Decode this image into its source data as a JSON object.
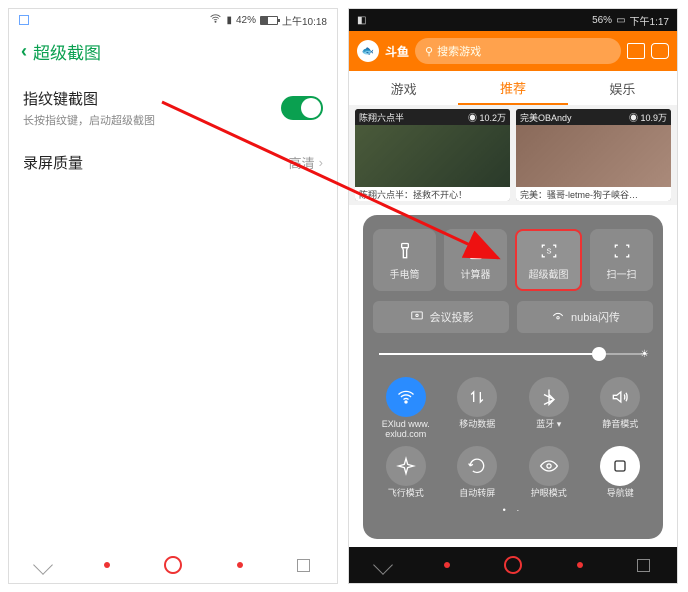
{
  "left": {
    "status": {
      "battery_pct": "42%",
      "time": "上午10:18"
    },
    "header": {
      "title": "超级截图"
    },
    "rows": [
      {
        "title": "指纹键截图",
        "subtitle": "长按指纹键，启动超级截图"
      },
      {
        "title": "录屏质量",
        "value": "高清"
      }
    ]
  },
  "right": {
    "status": {
      "signal": "56%",
      "time": "下午1:17"
    },
    "topbar": {
      "logo_text": "斗鱼",
      "search_placeholder": "搜索游戏"
    },
    "tabs": [
      "游戏",
      "推荐",
      "娱乐"
    ],
    "tabs_active": 1,
    "cards": [
      {
        "top_left": "陈翔六点半",
        "top_right": "◉ 10.2万",
        "bottom": "陈翔六点半：拯救不开心！"
      },
      {
        "top_left": "完美OBAndy",
        "top_right": "◉ 10.9万",
        "bottom": "完美：骚哥-letme-狗子峡谷…"
      }
    ],
    "cc": {
      "shortcuts": [
        {
          "label": "手电筒",
          "icon": "flashlight-icon"
        },
        {
          "label": "计算器",
          "icon": "calculator-icon"
        },
        {
          "label": "超级截图",
          "icon": "screenshot-icon",
          "highlight": true
        },
        {
          "label": "扫一扫",
          "icon": "scan-icon"
        }
      ],
      "wide": [
        {
          "label": "会议投影",
          "icon": "cast-icon"
        },
        {
          "label": "nubia闪传",
          "icon": "share-icon"
        }
      ],
      "quick": [
        {
          "label_line1": "EXlud www.",
          "label_line2": "exlud.com",
          "icon": "wifi-icon",
          "state": "on"
        },
        {
          "label_line1": "移动数据",
          "label_line2": "",
          "icon": "data-icon",
          "state": "off"
        },
        {
          "label_line1": "蓝牙",
          "label_line2": "",
          "icon": "bluetooth-icon",
          "state": "off",
          "chev": true
        },
        {
          "label_line1": "静音模式",
          "label_line2": "",
          "icon": "mute-icon",
          "state": "off"
        },
        {
          "label_line1": "飞行模式",
          "label_line2": "",
          "icon": "airplane-icon",
          "state": "off"
        },
        {
          "label_line1": "自动转屏",
          "label_line2": "",
          "icon": "rotate-icon",
          "state": "off"
        },
        {
          "label_line1": "护眼模式",
          "label_line2": "",
          "icon": "eye-icon",
          "state": "off"
        },
        {
          "label_line1": "导航键",
          "label_line2": "",
          "icon": "navkey-icon",
          "state": "white"
        }
      ],
      "brightness_pct": 82
    }
  }
}
